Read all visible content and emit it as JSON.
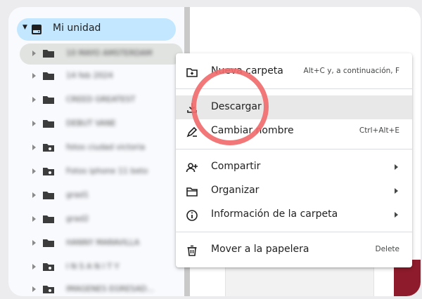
{
  "sidebar": {
    "root": {
      "label": "Mi unidad",
      "icon": "drive-icon"
    },
    "folders": [
      {
        "label": "10 MAYO AMSTERDAM",
        "selected": true
      },
      {
        "label": "14 feb 2024"
      },
      {
        "label": "CREED GREATEST"
      },
      {
        "label": "DEBUT VANE"
      },
      {
        "label": "fotos ciudad victoria",
        "shared": true
      },
      {
        "label": "Fotos iphone 11 beto",
        "shared": true
      },
      {
        "label": "grad1"
      },
      {
        "label": "grad2"
      },
      {
        "label": "HANNY MARAVILLA"
      },
      {
        "label": "I N S A N I T Y",
        "shared": true
      },
      {
        "label": "IMAGENES EGRESAD..."
      }
    ]
  },
  "context_menu": {
    "items": [
      {
        "label": "Nueva carpeta",
        "shortcut": "Alt+C y, a continuación, F",
        "icon": "new-folder-icon"
      },
      {
        "label": "Descargar",
        "shortcut": "",
        "icon": "download-icon",
        "highlighted": true
      },
      {
        "label": "Cambiar nombre",
        "shortcut": "Ctrl+Alt+E",
        "icon": "rename-icon"
      },
      {
        "label": "Compartir",
        "submenu": true,
        "icon": "share-icon"
      },
      {
        "label": "Organizar",
        "submenu": true,
        "icon": "organize-folder-icon"
      },
      {
        "label": "Información de la carpeta",
        "submenu": true,
        "icon": "info-icon"
      },
      {
        "label": "Mover a la papelera",
        "shortcut": "Delete",
        "icon": "trash-icon"
      }
    ]
  },
  "colors": {
    "root_highlight": "#c2e7ff",
    "menu_hover": "#e8e8e8",
    "annotation_circle": "#f06b6d"
  }
}
